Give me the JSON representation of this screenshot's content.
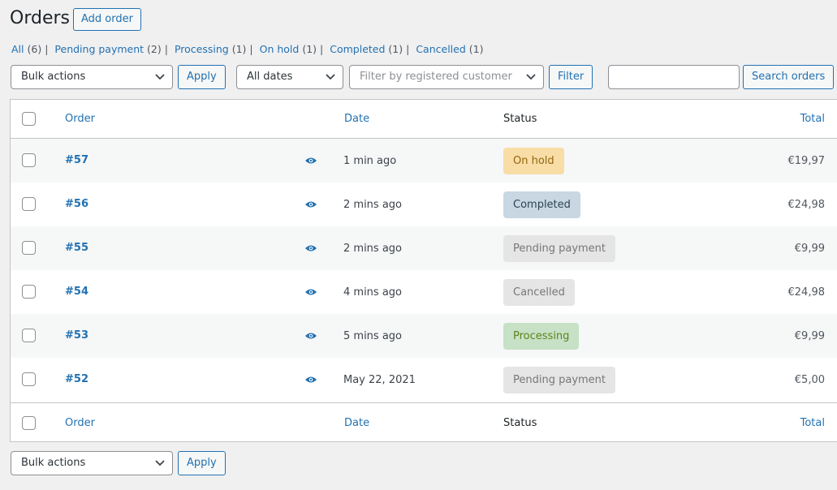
{
  "page": {
    "title": "Orders",
    "add_button": "Add order"
  },
  "filters": [
    {
      "label": "All",
      "count": "(6)",
      "current": true
    },
    {
      "label": "Pending payment",
      "count": "(2)"
    },
    {
      "label": "Processing",
      "count": "(1)"
    },
    {
      "label": "On hold",
      "count": "(1)"
    },
    {
      "label": "Completed",
      "count": "(1)"
    },
    {
      "label": "Cancelled",
      "count": "(1)"
    }
  ],
  "toolbar": {
    "bulk_actions": "Bulk actions",
    "apply": "Apply",
    "dates": "All dates",
    "customer_placeholder": "Filter by registered customer",
    "filter": "Filter",
    "search_button": "Search orders",
    "search_value": ""
  },
  "columns": {
    "order": "Order",
    "date": "Date",
    "status": "Status",
    "total": "Total"
  },
  "orders": [
    {
      "number": "#57",
      "date": "1 min ago",
      "status": "On hold",
      "status_bg": "#f8dda7",
      "status_fg": "#94660c",
      "total": "€19,97"
    },
    {
      "number": "#56",
      "date": "2 mins ago",
      "status": "Completed",
      "status_bg": "#c8d7e1",
      "status_fg": "#2e4453",
      "total": "€24,98"
    },
    {
      "number": "#55",
      "date": "2 mins ago",
      "status": "Pending payment",
      "status_bg": "#e5e5e5",
      "status_fg": "#777777",
      "total": "€9,99"
    },
    {
      "number": "#54",
      "date": "4 mins ago",
      "status": "Cancelled",
      "status_bg": "#e5e5e5",
      "status_fg": "#777777",
      "total": "€24,98"
    },
    {
      "number": "#53",
      "date": "5 mins ago",
      "status": "Processing",
      "status_bg": "#c6e1c6",
      "status_fg": "#5b841b",
      "total": "€9,99"
    },
    {
      "number": "#52",
      "date": "May 22, 2021",
      "status": "Pending payment",
      "status_bg": "#e5e5e5",
      "status_fg": "#777777",
      "total": "€5,00"
    }
  ],
  "bottom_toolbar": {
    "bulk_actions": "Bulk actions",
    "apply": "Apply"
  },
  "icons": {
    "preview": "eye-icon",
    "dropdown": "chevron-down-icon"
  },
  "colors": {
    "link": "#2271b1",
    "background": "#f0f0f1"
  }
}
